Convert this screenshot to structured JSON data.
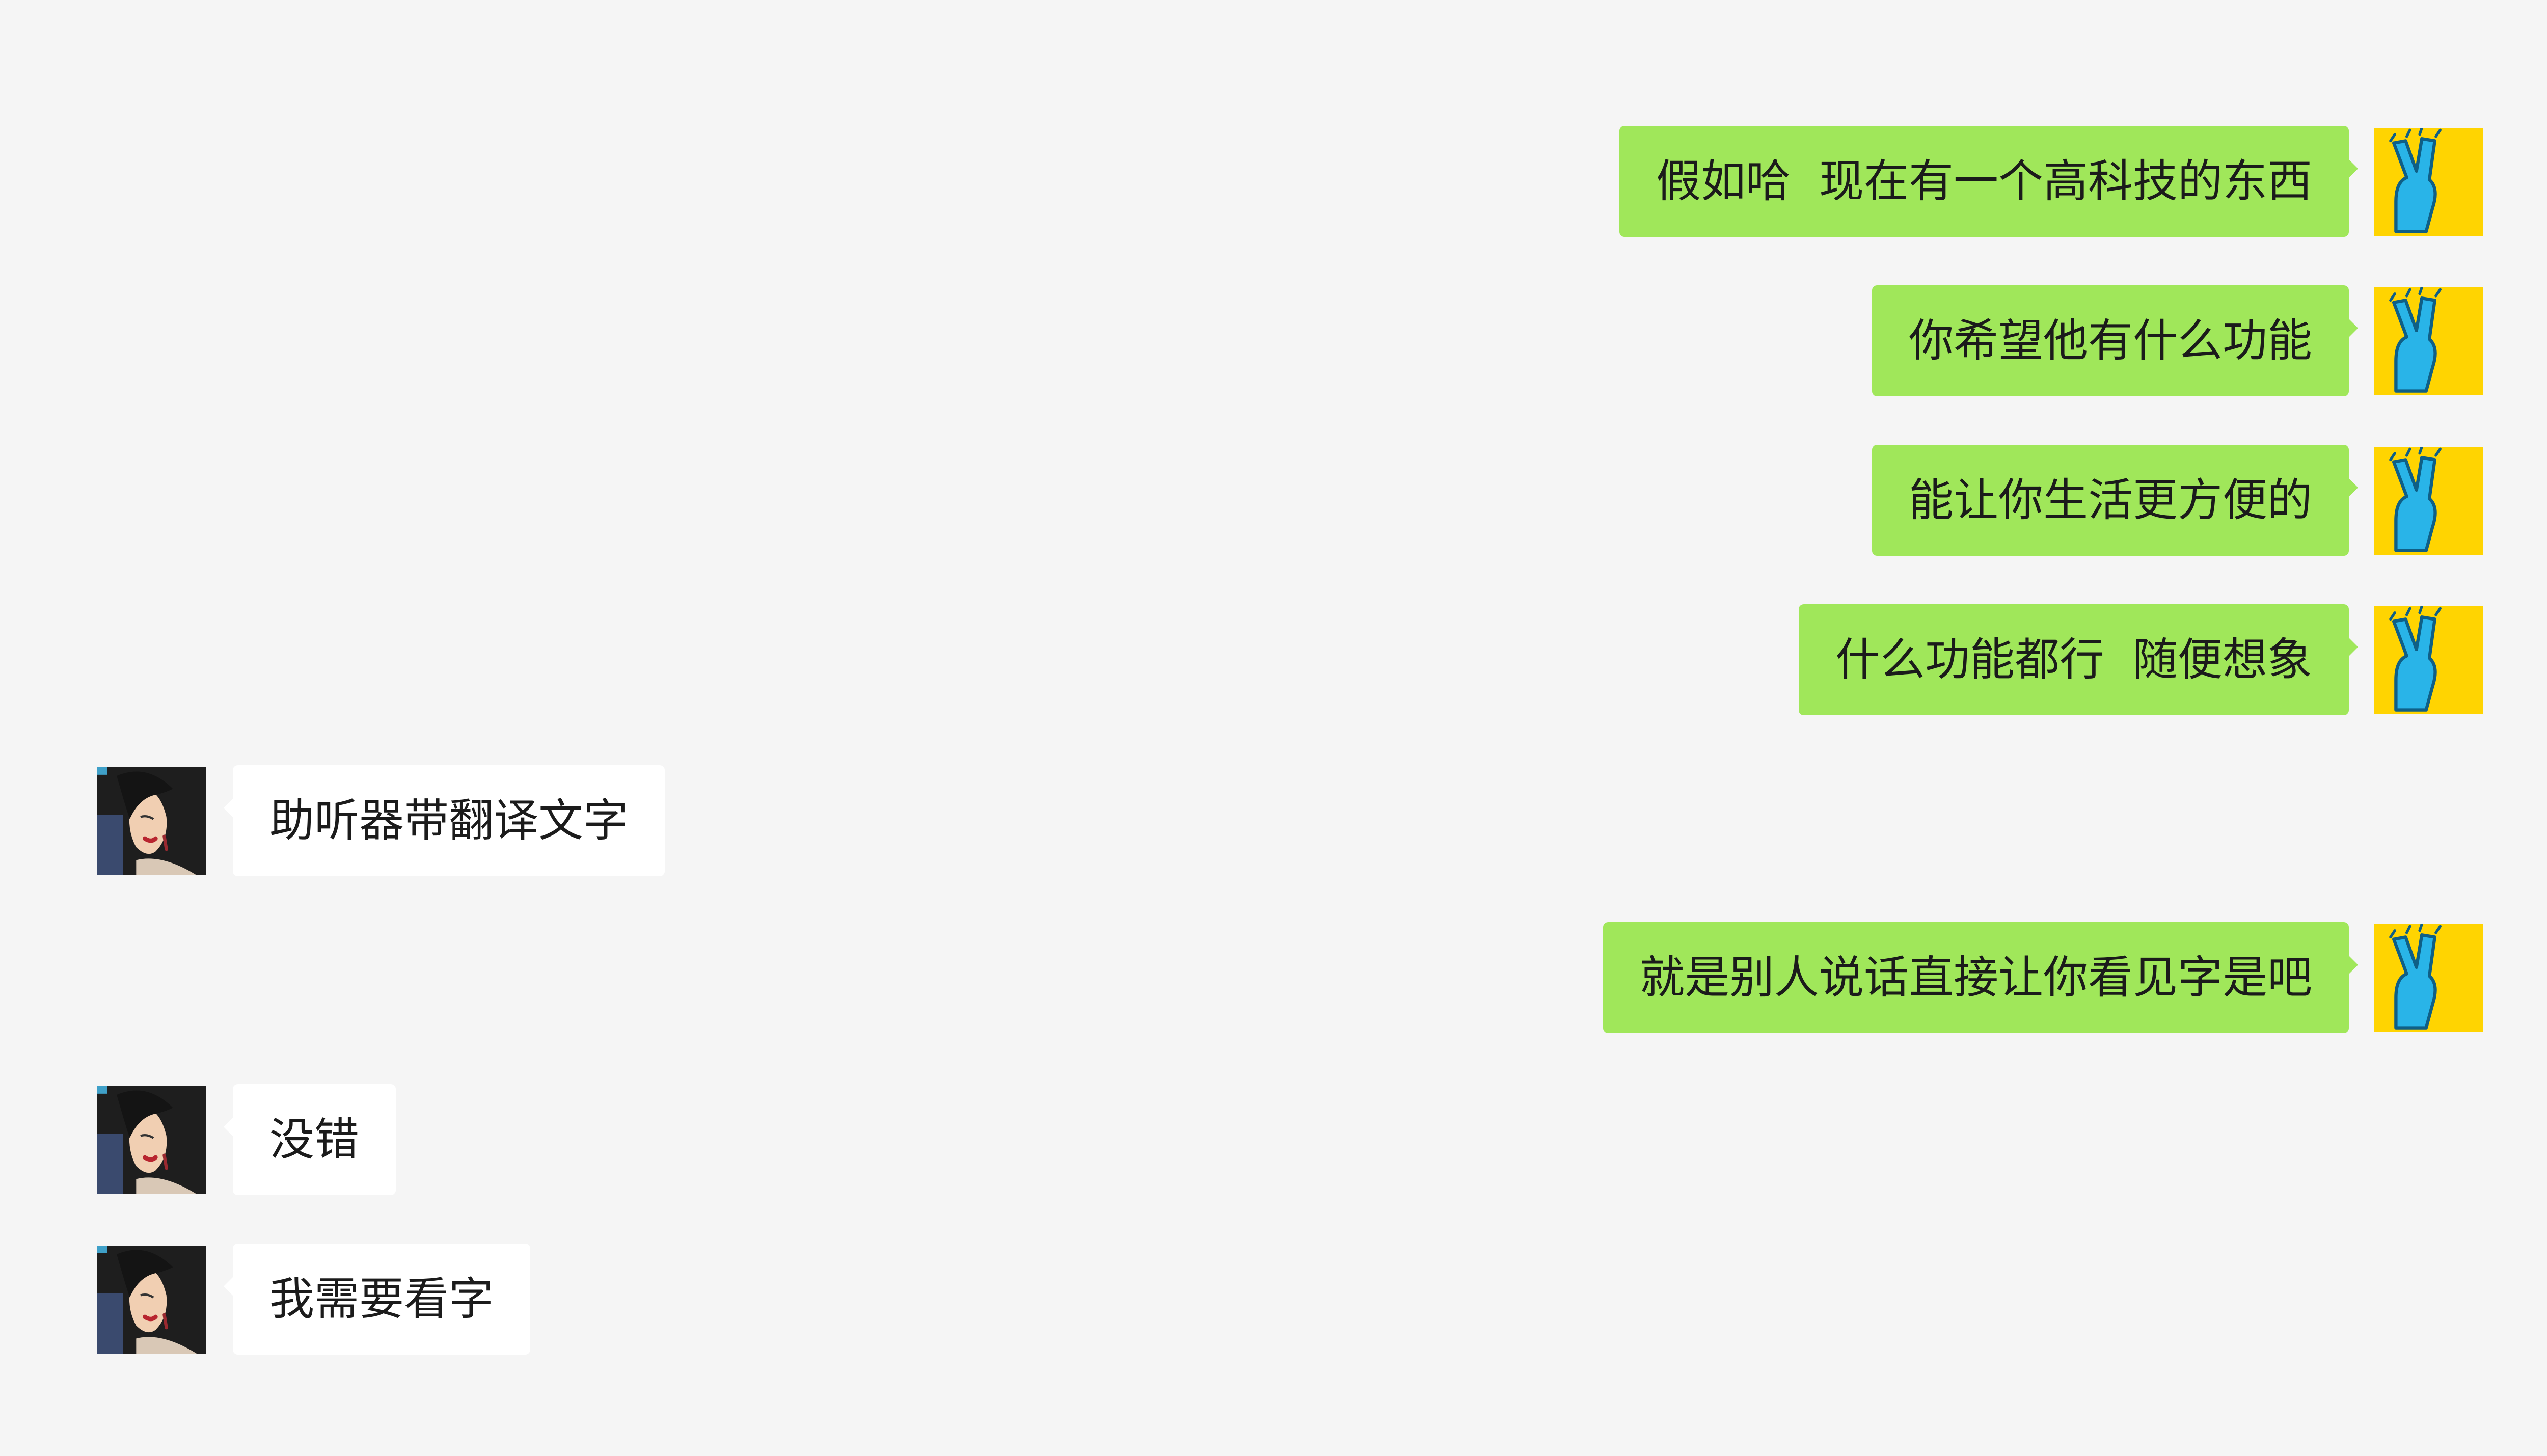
{
  "chat": {
    "messages": [
      {
        "side": "out",
        "text": "假如哈  现在有一个高科技的东西"
      },
      {
        "side": "out",
        "text": "你希望他有什么功能"
      },
      {
        "side": "out",
        "text": "能让你生活更方便的"
      },
      {
        "side": "out",
        "text": "什么功能都行  随便想象"
      },
      {
        "side": "in",
        "text": "助听器带翻译文字"
      },
      {
        "side": "out",
        "text": "就是别人说话直接让你看见字是吧"
      },
      {
        "side": "in",
        "text": "没错"
      },
      {
        "side": "in",
        "text": "我需要看字"
      }
    ]
  },
  "avatars": {
    "self": {
      "icon": "victory-hand-icon",
      "background": "#ffd401",
      "hand_color": "#29b4e8"
    },
    "contact": {
      "icon": "illustrated-woman-icon",
      "background": "#1e1e1e"
    }
  },
  "colors": {
    "chat_background": "#f5f5f5",
    "outgoing_bubble": "#a0e75a",
    "incoming_bubble": "#ffffff",
    "text": "#1b1b1b"
  }
}
